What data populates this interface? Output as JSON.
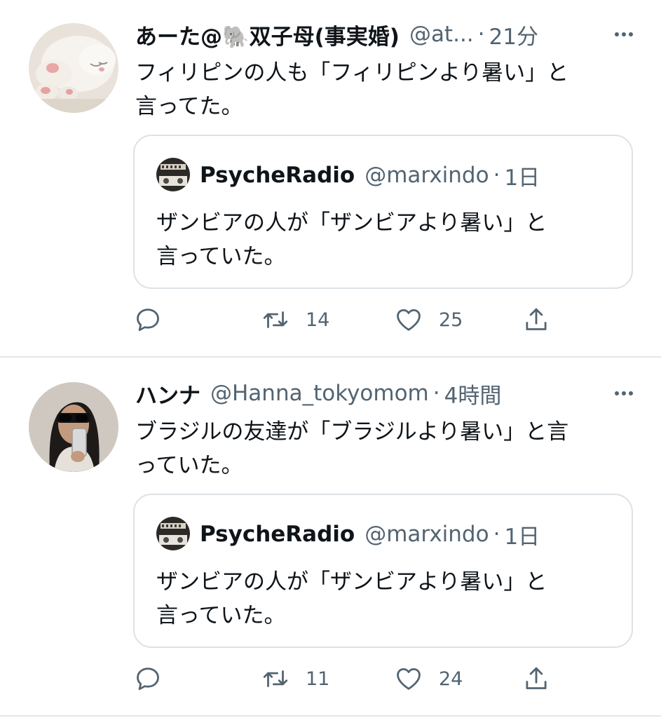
{
  "colors": {
    "text_primary": "#0f1419",
    "text_secondary": "#536471",
    "border": "#dde2e6",
    "divider": "#e3e6ea"
  },
  "tweets": [
    {
      "display_name": "あーた@🐘双子母(事実婚)",
      "handle": "@at...",
      "time": "21分",
      "text": "フィリピンの人も「フィリピンより暑い」と\n言ってた。",
      "avatar_icon": "cat-avatar",
      "quoted": {
        "display_name": "PsycheRadio",
        "handle": "@marxindo",
        "time": "1日",
        "text": "ザンビアの人が「ザンビアより暑い」と\n言っていた。",
        "avatar_icon": "radio-avatar"
      },
      "actions": {
        "reply_count": "",
        "retweet_count": "14",
        "like_count": "25"
      }
    },
    {
      "display_name": "ハンナ",
      "handle": "@Hanna_tokyomom",
      "time": "4時間",
      "text": "ブラジルの友達が「ブラジルより暑い」と言\nっていた。",
      "avatar_icon": "woman-avatar",
      "quoted": {
        "display_name": "PsycheRadio",
        "handle": "@marxindo",
        "time": "1日",
        "text": "ザンビアの人が「ザンビアより暑い」と\n言っていた。",
        "avatar_icon": "radio-avatar"
      },
      "actions": {
        "reply_count": "",
        "retweet_count": "11",
        "like_count": "24"
      }
    }
  ],
  "separator": "·"
}
